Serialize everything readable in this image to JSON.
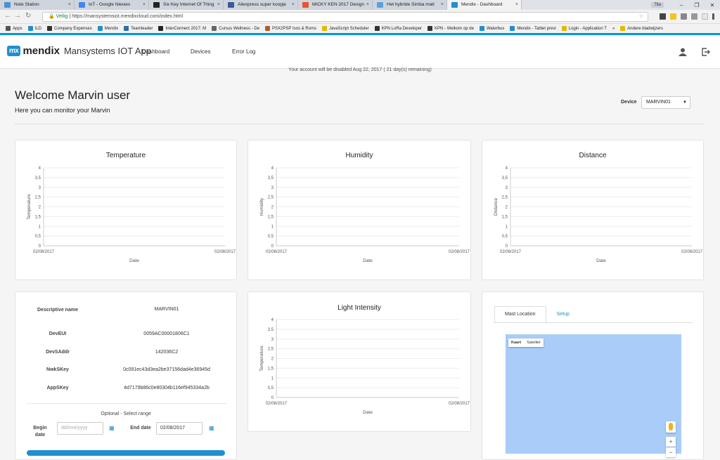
{
  "browser": {
    "tabs": [
      {
        "label": "Note Station",
        "icon_color": "#4a90d9"
      },
      {
        "label": "IoT - Google Nieuws",
        "icon_color": "#4285f4"
      },
      {
        "label": "Six Key Internet Of Thing",
        "icon_color": "#222222"
      },
      {
        "label": "Aliexpress super koopje",
        "icon_color": "#3b5998"
      },
      {
        "label": "MICKY KEN 2017 Design",
        "icon_color": "#e8542f"
      },
      {
        "label": "Het hybride Simba matr",
        "icon_color": "#5aa0e0"
      },
      {
        "label": "Mendix - Dashboard",
        "icon_color": "#1e8fd1"
      }
    ],
    "close_glyph": "×",
    "user_badge": "Tita",
    "window_controls": [
      "–",
      "❐",
      "✕"
    ],
    "secure_label": "Veilig",
    "url": "https://mansystemsiot.mendixcloud.com/index.html",
    "bookmarks": [
      {
        "label": "Apps",
        "icon_color": "#555555"
      },
      {
        "label": "ILD",
        "icon_color": "#1e8fd1"
      },
      {
        "label": "Company Expenses",
        "icon_color": "#333333"
      },
      {
        "label": "Mendix",
        "icon_color": "#1e8fd1"
      },
      {
        "label": "Teamleader",
        "icon_color": "#2b6cb0"
      },
      {
        "label": "InterConnect 2017: M",
        "icon_color": "#222222"
      },
      {
        "label": "Cursus Wellness - De",
        "icon_color": "#666666"
      },
      {
        "label": "PSX2PSP Isos & Roms",
        "icon_color": "#b55a2a"
      },
      {
        "label": "JavaScript Scheduler",
        "icon_color": "#e6b800"
      },
      {
        "label": "KPN LoRa Developer",
        "icon_color": "#333333"
      },
      {
        "label": "KPN - Welkom op de",
        "icon_color": "#333333"
      },
      {
        "label": "Waterbus",
        "icon_color": "#1e8fd1"
      },
      {
        "label": "Mendix - Tablet previ",
        "icon_color": "#1e8fd1"
      },
      {
        "label": "Login - Application T",
        "icon_color": "#e6b800"
      }
    ],
    "bookmarks_overflow": "»",
    "other_bookmarks": "Andere bladwijzers"
  },
  "app": {
    "logo_mx": "mx",
    "logo_mendix": "mendix",
    "app_name": "Mansystems IOT App",
    "nav": [
      "Dashboard",
      "Devices",
      "Error Log"
    ],
    "notice": "Your account will be disabled Aug 22, 2017 ( 21 day(s) remaining)",
    "welcome": "Welcome Marvin user",
    "subtitle": "Here you can monitor your Marvin",
    "device_label": "Device",
    "device_value": "MARVIN01"
  },
  "device_info": {
    "rows": [
      {
        "key": "Descriptive name",
        "value": "MARVIN01"
      },
      {
        "key": "DevEUI",
        "value": "0059AC00001806C1"
      },
      {
        "key": "DevSAddr",
        "value": "142036C2"
      },
      {
        "key": "NwkSKey",
        "value": "0c091ec43d3ea2be37156dad4e36945d"
      },
      {
        "key": "AppSKey",
        "value": "4d7179b86c0e80304b116ef945334a2b"
      }
    ],
    "range_header": "Optional - Select range",
    "begin_label": "Begin date",
    "begin_placeholder": "dd/mm/yyyy",
    "end_label": "End date",
    "end_value": "02/08/2017"
  },
  "map_panel": {
    "tabs": [
      "Mast Location",
      "Setup"
    ],
    "map_types": [
      "Kaart",
      "Satelliet"
    ],
    "zoom_in": "+",
    "zoom_out": "−"
  },
  "chart_data": [
    {
      "type": "line",
      "title": "Temperature",
      "xlabel": "Date",
      "ylabel": "Temperature",
      "x_ticks": [
        "02/08/2017",
        "02/08/2017"
      ],
      "y_ticks": [
        "0",
        "0,5",
        "1",
        "1,5",
        "2",
        "2,5",
        "3",
        "3,5",
        "4"
      ],
      "ylim": [
        0,
        4
      ],
      "series": []
    },
    {
      "type": "line",
      "title": "Humidity",
      "xlabel": "Date",
      "ylabel": "Humidity",
      "x_ticks": [
        "02/08/2017",
        "02/08/2017"
      ],
      "y_ticks": [
        "0",
        "0,5",
        "1",
        "1,5",
        "2",
        "2,5",
        "3",
        "3,5",
        "4"
      ],
      "ylim": [
        0,
        4
      ],
      "series": []
    },
    {
      "type": "line",
      "title": "Distance",
      "xlabel": "Date",
      "ylabel": "Distance",
      "x_ticks": [
        "02/08/2017",
        "02/08/2017"
      ],
      "y_ticks": [
        "0",
        "0,5",
        "1",
        "1,5",
        "2",
        "2,5",
        "3",
        "3,5",
        "4"
      ],
      "ylim": [
        0,
        4
      ],
      "series": []
    },
    {
      "type": "line",
      "title": "Light Intensity",
      "xlabel": "Date",
      "ylabel": "Temperature",
      "x_ticks": [
        "02/08/2017",
        "02/08/2017"
      ],
      "y_ticks": [
        "0",
        "0,5",
        "1",
        "1,5",
        "2",
        "2,5",
        "3",
        "3,5",
        "4"
      ],
      "ylim": [
        0,
        4
      ],
      "series": []
    }
  ]
}
